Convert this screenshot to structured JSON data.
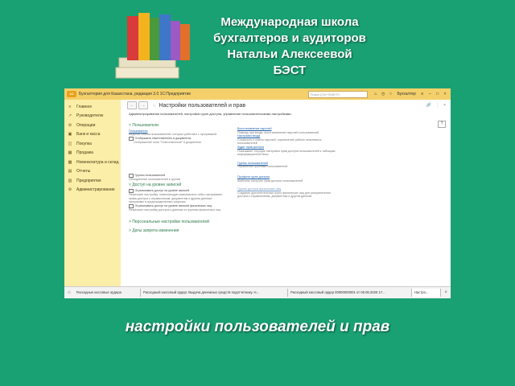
{
  "banner": {
    "line1": "Международная школа",
    "line2": "бухгалтеров и аудиторов",
    "line3": "Натальи Алексеевой",
    "line4": "БЭСТ"
  },
  "window": {
    "app_title": "Бухгалтерия для Казахстана, редакция 3.0 1С:Предприятие",
    "logo": "1С",
    "search_placeholder": "Поиск (Ctrl+Shift+F)",
    "user": "Бухгалтер"
  },
  "sidebar": {
    "items": [
      {
        "label": "Главное",
        "icon": "menu-icon"
      },
      {
        "label": "Руководителю",
        "icon": "chart-icon"
      },
      {
        "label": "Операции",
        "icon": "operations-icon"
      },
      {
        "label": "Банк и касса",
        "icon": "bank-icon"
      },
      {
        "label": "Покупка",
        "icon": "cart-icon"
      },
      {
        "label": "Продажа",
        "icon": "sale-icon"
      },
      {
        "label": "Номенклатура и склад",
        "icon": "warehouse-icon"
      },
      {
        "label": "Отчеты",
        "icon": "reports-icon"
      },
      {
        "label": "Предприятие",
        "icon": "enterprise-icon"
      },
      {
        "label": "Администрирование",
        "icon": "gear-icon"
      }
    ]
  },
  "main": {
    "title": "Настройки пользователей и прав",
    "subtitle": "Администрирование пользователей, настройка групп доступа, управление пользовательскими настройками.",
    "help": "?",
    "left": {
      "section_users": "Пользователи",
      "users_link": "Пользователи",
      "users_desc": "Ведение списка пользователей, которые работают с программой.",
      "chk_responsible": "Отображать ответственного в документах",
      "chk_responsible_desc": "Отображение поля \"Ответственный\" в документах",
      "chk_groups": "Группы пользователей",
      "chk_groups_desc": "Объединение пользователей в группы",
      "section_records": "Доступ на уровне записей",
      "chk_restrict": "Ограничивать доступ на уровне записей",
      "chk_restrict_desc": "Разрешает настройку, позволяющую максимально гибко настраивать права доступа к справочникам, документам и другим данным программы в предопределенных разрезах.",
      "chk_restrict_phys": "Ограничивать доступ на уровне записей физических лиц",
      "chk_restrict_phys_desc": "Разрешает настройку доступа к данным по группам физических лиц",
      "personal": "Персональные настройки пользователей",
      "dates": "Даты запрета изменения"
    },
    "right": {
      "restore_link": "Восстановление паролей",
      "restore_desc": "Помощь при входе, восстановление паролей пользователей",
      "login_link": "Настройки входа",
      "login_desc": "Сложность и смена паролей, ограничение работы неактивных пользователей",
      "access_link": "Аудит прав доступа",
      "access_desc": "Показывает текущие настройки прав доступа пользователей к таблицам информационной базы",
      "groups_link": "Группы пользователей",
      "groups_desc": "Управление группами пользователей",
      "profiles_link": "Профили групп доступа",
      "profiles_desc": "Шаблоны настроек прав доступа пользователей",
      "phys_link": "Группы доступа физических лиц",
      "phys_desc": "Создание дополнительных групп физических лиц для разграничения доступа к справочникам, документам и другим данным"
    }
  },
  "taskbar": {
    "tabs": [
      "Расходные кассовые ордера",
      "Расходный кассовый ордер: Выдача денежных средств подотчетнику. Н...",
      "Расходный кассовый ордер 00000000001 от 06.08.2020 17...",
      "Настро..."
    ]
  },
  "caption": "настройки пользователей и прав",
  "colors": {
    "background": "#19a174",
    "sidebar": "#fbeea8",
    "titlebar": "#f4d06b",
    "link": "#1c5fa8",
    "section": "#2f7a4a"
  }
}
